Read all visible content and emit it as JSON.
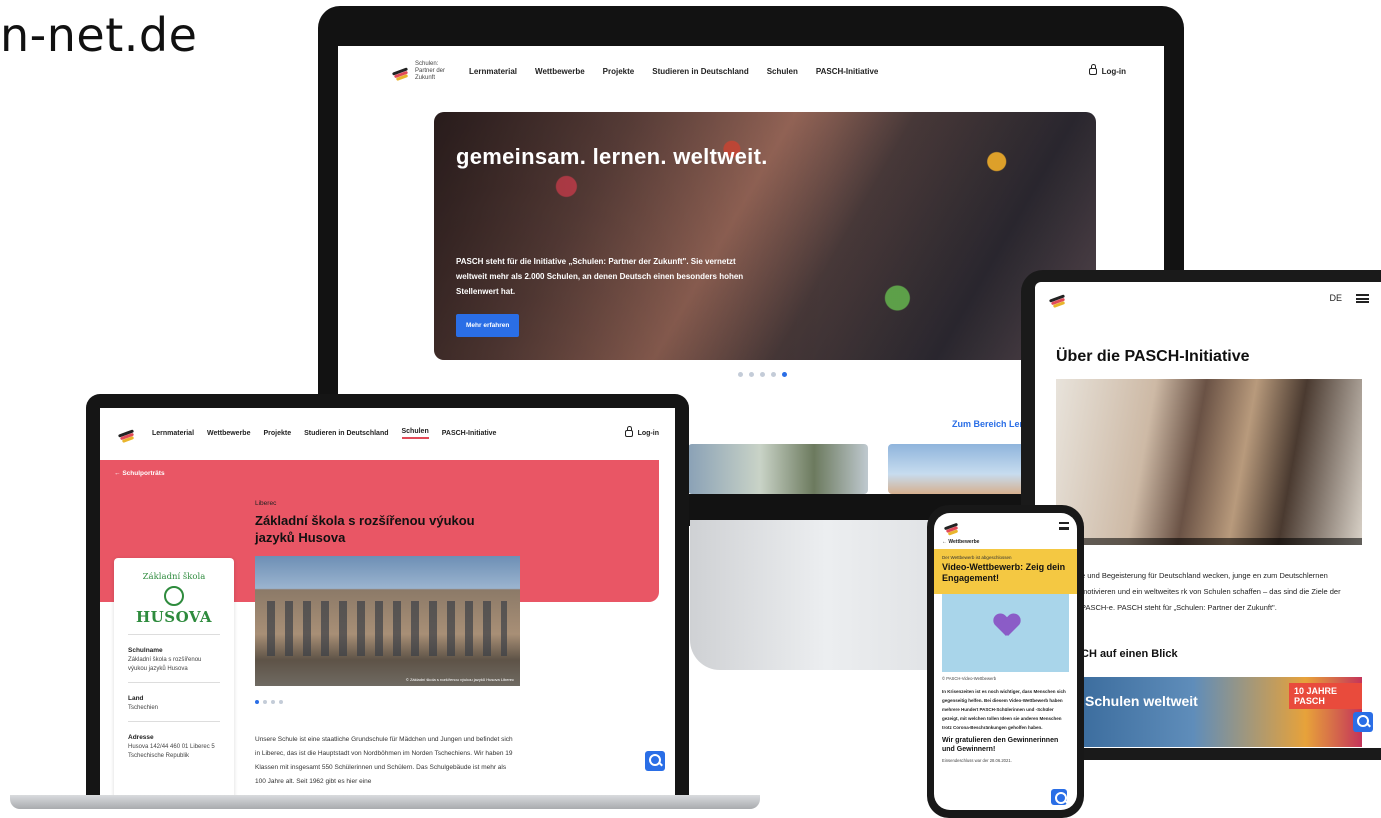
{
  "url_fragment": "n-net.de",
  "logo": {
    "text": "Schulen: Partner der Zukunft"
  },
  "desktop": {
    "nav": [
      "Lernmaterial",
      "Wettbewerbe",
      "Projekte",
      "Studieren in Deutschland",
      "Schulen",
      "PASCH-Initiative"
    ],
    "login": "Log-in",
    "hero_title": "gemeinsam. lernen. weltweit.",
    "hero_text": "PASCH steht für die Initiative „Schulen: Partner der Zukunft\". Sie vernetzt weltweit mehr als 2.000 Schulen, an denen Deutsch einen besonders hohen Stellenwert hat.",
    "hero_button": "Mehr erfahren",
    "section_link": "Zum Bereich Lern"
  },
  "tablet": {
    "lang": "DE",
    "title": "Über die PASCH-Initiative",
    "paragraph": "e und Begeisterung für Deutschland wecken, junge en zum Deutschlernen motivieren und ein weltweites rk von Schulen schaffen – das sind die Ziele der PASCH-e. PASCH steht für „Schulen: Partner der Zukunft\".",
    "subheading": "CH auf einen Blick",
    "banner_text": "Schulen weltweit",
    "banner_badge": "10 JAHRE PASCH"
  },
  "laptop": {
    "nav": [
      "Lernmaterial",
      "Wettbewerbe",
      "Projekte",
      "Studieren in Deutschland",
      "Schulen",
      "PASCH-Initiative"
    ],
    "login": "Log-in",
    "back_link": "Schulporträts",
    "city": "Liberec",
    "school_title": "Základní škola s rozšířenou výukou jazyků Husova",
    "logo_small": "Základní škola",
    "logo_big": "HUSOVA",
    "photo_caption": "© Základní škola s rozšířenou výukou jazyků Husova Liberec",
    "schulname_label": "Schulname",
    "schulname_value": "Základní škola s rozšířenou výukou jazyků Husova",
    "land_label": "Land",
    "land_value": "Tschechien",
    "adresse_label": "Adresse",
    "adresse_value": "Husova 142/44 460 01 Liberec 5 Tschechische Republik",
    "paragraph": "Unsere Schule ist eine staatliche Grundschule für Mädchen und Jungen und befindet sich in Liberec, das ist die Hauptstadt von Nordböhmen im Norden Tschechiens. Wir haben 19 Klassen mit insgesamt 550 Schülerinnen und Schülern. Das Schulgebäude ist mehr als 100 Jahre alt. Seit 1962 gibt es hier eine"
  },
  "phone": {
    "back": "Wettbewerbe",
    "status": "Der Wettbewerb ist abgeschlossen",
    "title": "Video-Wettbewerb: Zeig dein Engagement!",
    "image_caption": "© PASCH-Video-Wettbewerb",
    "text": "In Krisenzeiten ist es noch wichtiger, dass Menschen sich gegenseitig helfen. Bei diesem Video-Wettbewerb haben mehrere Hundert PASCH-Schülerinnen und -Schüler gezeigt, mit welchen tollen Ideen sie anderen Menschen trotz Corona-Beschränkungen geholfen haben.",
    "subtitle": "Wir gratulieren den Gewinnerinnen und Gewinnern!",
    "small": "Einsendeschluss war der 28.06.2021."
  },
  "colors": {
    "accent": "#2a6ee6",
    "school_red": "#e95665",
    "phone_yellow": "#f4c842",
    "husova_green": "#2e8b3d"
  }
}
